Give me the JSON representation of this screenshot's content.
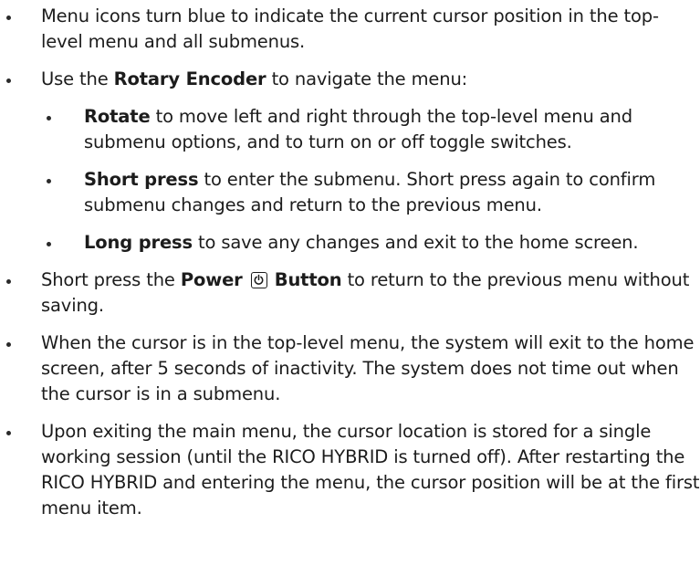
{
  "bullets": {
    "b1": "Menu icons turn blue to indicate the current cursor position in the top-level menu and all submenus.",
    "b2_pre": "Use the ",
    "b2_bold": "Rotary Encoder",
    "b2_post": " to navigate the menu:",
    "sub1_bold": "Rotate",
    "sub1_text": " to move left and right through the top-level menu and submenu options, and to turn on or off toggle switches.",
    "sub2_bold": "Short press",
    "sub2_text": " to enter the submenu. Short press again to confirm submenu changes and return to the previous menu.",
    "sub3_bold": "Long press",
    "sub3_text": " to save any changes and exit to the home screen.",
    "b3_pre": "Short press the ",
    "b3_bold1": "Power",
    "b3_bold2": "Button",
    "b3_post": " to return to the previous menu without saving.",
    "b4": "When the cursor is in the top-level menu, the system will exit to the home screen, after 5 seconds of inactivity. The system does not time out when the cursor is in a submenu.",
    "b5": "Upon exiting the main menu, the cursor location is stored for a single working session (until the RICO HYBRID is turned off). After restarting the RICO HYBRID and entering the menu, the cursor position will be at the first menu item."
  },
  "icons": {
    "power": "power-icon"
  }
}
